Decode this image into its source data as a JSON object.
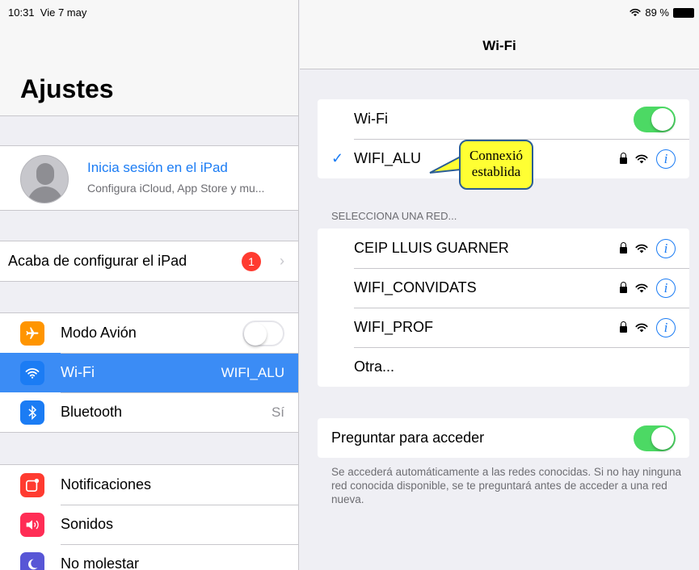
{
  "status_bar": {
    "time": "10:31",
    "date": "Vie 7 may",
    "battery_percent": "89 %",
    "wifi_icon": "wifi-icon",
    "battery_icon": "battery-icon"
  },
  "sidebar": {
    "title": "Ajustes",
    "profile": {
      "title": "Inicia sesión en el iPad",
      "subtitle": "Configura iCloud, App Store y mu..."
    },
    "setup": {
      "label": "Acaba de configurar el iPad",
      "badge": "1"
    },
    "items": [
      {
        "label": "Modo Avión",
        "icon": "airplane-icon",
        "color": "#ff9500",
        "toggle": false
      },
      {
        "label": "Wi-Fi",
        "value": "WIFI_ALU",
        "icon": "wifi-icon",
        "color": "#1b7cf4",
        "selected": true
      },
      {
        "label": "Bluetooth",
        "value": "Sí",
        "icon": "bluetooth-icon",
        "color": "#1b7cf4"
      }
    ],
    "items2": [
      {
        "label": "Notificaciones",
        "icon": "notifications-icon",
        "color": "#ff3b30"
      },
      {
        "label": "Sonidos",
        "icon": "sounds-icon",
        "color": "#ff2d55"
      },
      {
        "label": "No molestar",
        "icon": "moon-icon",
        "color": "#5856d6"
      }
    ]
  },
  "wifi_panel": {
    "title": "Wi-Fi",
    "wifi_label": "Wi-Fi",
    "wifi_on": true,
    "connected_network": "WIFI_ALU",
    "section_header": "SELECCIONA UNA RED...",
    "networks": [
      {
        "name": "CEIP LLUIS GUARNER"
      },
      {
        "name": "WIFI_CONVIDATS"
      },
      {
        "name": "WIFI_PROF"
      }
    ],
    "other_label": "Otra...",
    "ask_to_join_label": "Preguntar para acceder",
    "ask_to_join_on": true,
    "footer": "Se accederá automáticamente a las redes conocidas. Si no hay ninguna red conocida disponible, se te preguntará antes de acceder a una red nueva."
  },
  "callout": {
    "line1": "Connexió",
    "line2": "establida"
  }
}
